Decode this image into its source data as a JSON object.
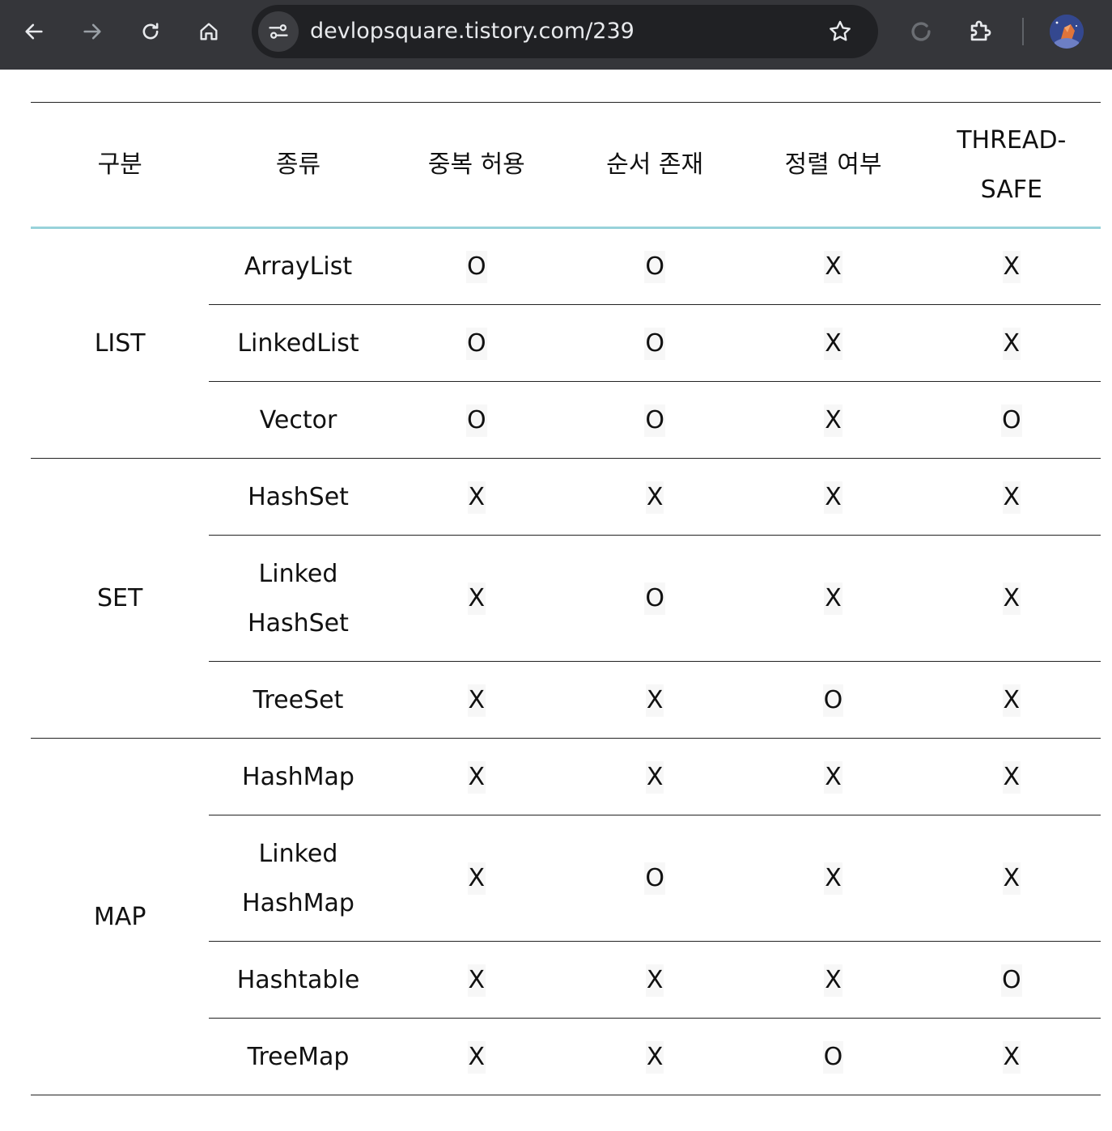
{
  "browser": {
    "url": "devlopsquare.tistory.com/239",
    "icons": [
      "back-arrow-icon",
      "forward-arrow-icon",
      "reload-icon",
      "home-icon",
      "site-info-icon",
      "bookmark-star-icon",
      "sync-icon",
      "extensions-icon",
      "profile-avatar-icon"
    ],
    "colors": {
      "toolbar": "#35363a",
      "omnibox": "#202124",
      "header_divider": "#98d2da"
    }
  },
  "table": {
    "headers": [
      "구분",
      "종류",
      "중복 허용",
      "순서 존재",
      "정렬 여부",
      "THREAD-SAFE"
    ],
    "groups": [
      {
        "category": "LIST",
        "rows": [
          {
            "type": "ArrayList",
            "dup": "O",
            "order": "O",
            "sorted": "X",
            "thread_safe": "X"
          },
          {
            "type": "LinkedList",
            "dup": "O",
            "order": "O",
            "sorted": "X",
            "thread_safe": "X"
          },
          {
            "type": "Vector",
            "dup": "O",
            "order": "O",
            "sorted": "X",
            "thread_safe": "O"
          }
        ]
      },
      {
        "category": "SET",
        "rows": [
          {
            "type": "HashSet",
            "dup": "X",
            "order": "X",
            "sorted": "X",
            "thread_safe": "X"
          },
          {
            "type": "Linked HashSet",
            "dup": "X",
            "order": "O",
            "sorted": "X",
            "thread_safe": "X"
          },
          {
            "type": "TreeSet",
            "dup": "X",
            "order": "X",
            "sorted": "O",
            "thread_safe": "X"
          }
        ]
      },
      {
        "category": "MAP",
        "rows": [
          {
            "type": "HashMap",
            "dup": "X",
            "order": "X",
            "sorted": "X",
            "thread_safe": "X"
          },
          {
            "type": "Linked HashMap",
            "dup": "X",
            "order": "O",
            "sorted": "X",
            "thread_safe": "X"
          },
          {
            "type": "Hashtable",
            "dup": "X",
            "order": "X",
            "sorted": "X",
            "thread_safe": "O"
          },
          {
            "type": "TreeMap",
            "dup": "X",
            "order": "X",
            "sorted": "O",
            "thread_safe": "X"
          }
        ]
      }
    ]
  }
}
